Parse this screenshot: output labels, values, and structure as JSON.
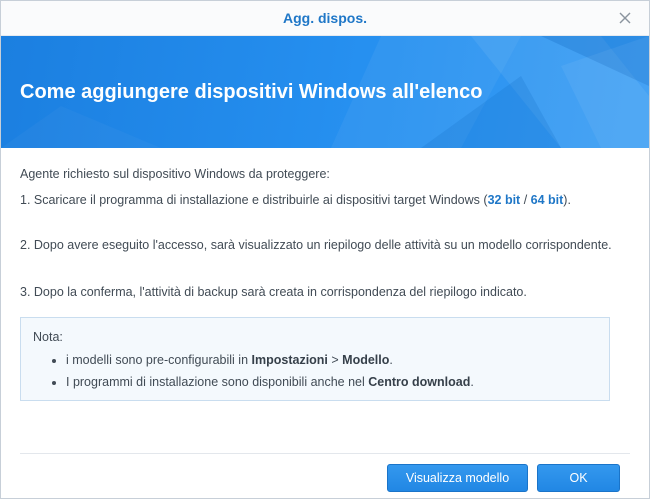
{
  "window": {
    "title": "Agg. dispos."
  },
  "banner": {
    "title": "Come aggiungere dispositivi Windows all'elenco"
  },
  "content": {
    "intro": "Agente richiesto sul dispositivo Windows da proteggere:",
    "step1_text": "1. Scaricare il programma di installazione e distribuirle ai dispositivi target Windows (",
    "step1_link32": "32 bit",
    "step1_sep": " / ",
    "step1_link64": "64 bit",
    "step1_end": ").",
    "step2": "2. Dopo avere eseguito l'accesso, sarà visualizzato un riepilogo delle attività su un modello corrispondente.",
    "step3": "3. Dopo la conferma, l'attività di backup sarà creata in corrispondenza del riepilogo indicato."
  },
  "note": {
    "title": "Nota:",
    "item1_pre": "i modelli sono pre-configurabili in ",
    "item1_b1": "Impostazioni",
    "item1_mid": " > ",
    "item1_b2": "Modello",
    "item1_end": ".",
    "item2_pre": "I programmi di installazione sono disponibili anche nel ",
    "item2_b": "Centro download",
    "item2_end": "."
  },
  "buttons": {
    "model": "Visualizza modello",
    "ok": "OK"
  },
  "colors": {
    "accent": "#1f77c7",
    "banner": "#2690f0",
    "note_bg": "#f4f9fd"
  },
  "icons": {
    "close": "close-icon"
  }
}
